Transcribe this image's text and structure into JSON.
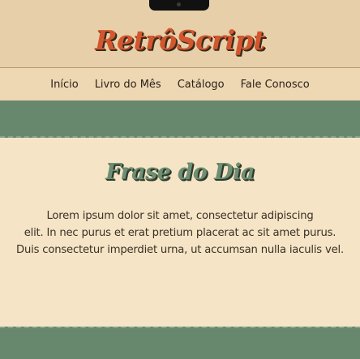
{
  "header": {
    "logo_text": "RetrôScript"
  },
  "nav": {
    "items": [
      {
        "label": "Início"
      },
      {
        "label": "Livro do Mês"
      },
      {
        "label": "Catálogo"
      },
      {
        "label": "Fale Conosco"
      }
    ]
  },
  "quote": {
    "title": "Frase do Dia",
    "lines": [
      "Lorem ipsum dolor sit amet, consectetur adipiscing",
      "elit. In nec purus et erat pretium placerat ac sit amet purus.",
      "Duis consectetur imperdiet urna, ut accumsan nulla iaculis vel."
    ]
  },
  "colors": {
    "logo": "#d2572e",
    "header_bg": "#e7cfa9",
    "nav_bg": "#eed7b3",
    "band_green": "#68886d",
    "main_bg": "#f5e4c5",
    "title_green": "#6e8f73"
  }
}
